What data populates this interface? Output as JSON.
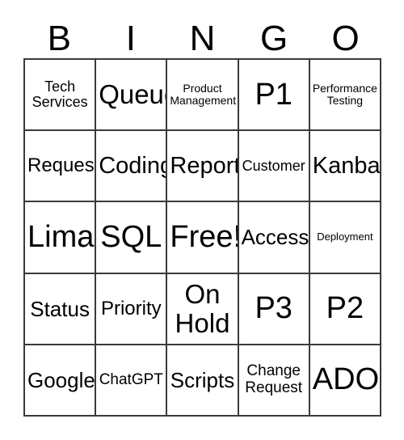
{
  "card": {
    "title": "BINGO",
    "header_letters": [
      "B",
      "I",
      "N",
      "G",
      "O"
    ],
    "border_color": "#3a3a3a",
    "background_color": "#ffffff",
    "text_color": "#000000",
    "grid_size": "5x5",
    "free_space_label": "Free!",
    "rows": [
      [
        {
          "label": "Tech\nServices",
          "size": "md"
        },
        {
          "label": "Queue",
          "size": "xxl"
        },
        {
          "label": "Product\nManagement",
          "size": "sm"
        },
        {
          "label": "P1",
          "size": "huge"
        },
        {
          "label": "Performance\nTesting",
          "size": "sm"
        }
      ],
      [
        {
          "label": "Request",
          "size": "lg"
        },
        {
          "label": "Coding",
          "size": "xl"
        },
        {
          "label": "Reports",
          "size": "xl"
        },
        {
          "label": "Customer",
          "size": "md"
        },
        {
          "label": "Kanban",
          "size": "xl"
        }
      ],
      [
        {
          "label": "Lima",
          "size": "huge"
        },
        {
          "label": "SQL",
          "size": "huge"
        },
        {
          "label": "Free!",
          "size": "huge"
        },
        {
          "label": "Access",
          "size": "lg2"
        },
        {
          "label": "Deployment",
          "size": "xs"
        }
      ],
      [
        {
          "label": "Status",
          "size": "lg2"
        },
        {
          "label": "Priority",
          "size": "lg"
        },
        {
          "label": "On\nHold",
          "size": "xxl"
        },
        {
          "label": "P3",
          "size": "huge"
        },
        {
          "label": "P2",
          "size": "huge"
        }
      ],
      [
        {
          "label": "Google",
          "size": "lg2"
        },
        {
          "label": "ChatGPT",
          "size": "md2"
        },
        {
          "label": "Scripts",
          "size": "lg2"
        },
        {
          "label": "Change\nRequest",
          "size": "md2"
        },
        {
          "label": "ADO",
          "size": "huge"
        }
      ]
    ]
  }
}
